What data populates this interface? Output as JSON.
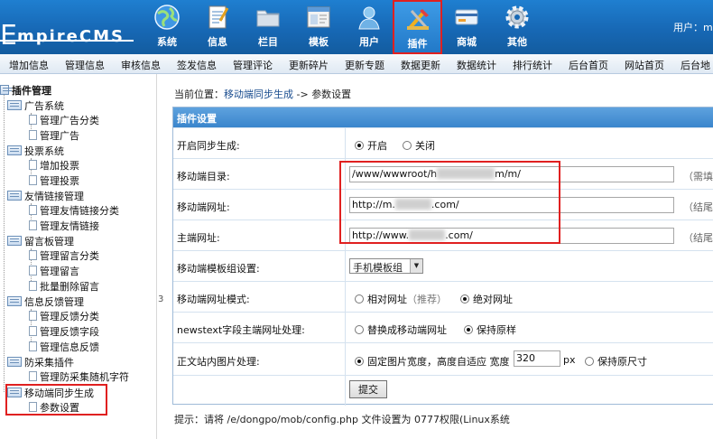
{
  "header": {
    "logo_first": "E",
    "logo_rest": "mpireCMS",
    "user_label": "用户：m",
    "nav": [
      {
        "label": "系统",
        "icon": "globe-icon"
      },
      {
        "label": "信息",
        "icon": "document-icon"
      },
      {
        "label": "栏目",
        "icon": "folder-icon"
      },
      {
        "label": "模板",
        "icon": "window-icon"
      },
      {
        "label": "用户",
        "icon": "user-icon"
      },
      {
        "label": "插件",
        "icon": "tools-icon"
      },
      {
        "label": "商城",
        "icon": "card-icon"
      },
      {
        "label": "其他",
        "icon": "gear-icon"
      }
    ],
    "active_nav": "插件"
  },
  "toolbar": [
    "增加信息",
    "管理信息",
    "审核信息",
    "签发信息",
    "管理评论",
    "更新碎片",
    "更新专题",
    "数据更新",
    "数据统计",
    "排行统计",
    "后台首页",
    "网站首页",
    "后台地"
  ],
  "sidebar": {
    "root": "插件管理",
    "groups": [
      {
        "label": "广告系统",
        "children": [
          "管理广告分类",
          "管理广告"
        ]
      },
      {
        "label": "投票系统",
        "children": [
          "增加投票",
          "管理投票"
        ]
      },
      {
        "label": "友情链接管理",
        "children": [
          "管理友情链接分类",
          "管理友情链接"
        ]
      },
      {
        "label": "留言板管理",
        "children": [
          "管理留言分类",
          "管理留言",
          "批量删除留言"
        ]
      },
      {
        "label": "信息反馈管理",
        "children": [
          "管理反馈分类",
          "管理反馈字段",
          "管理信息反馈"
        ]
      },
      {
        "label": "防采集插件",
        "children": [
          "管理防采集随机字符"
        ]
      },
      {
        "label": "移动端同步生成",
        "children": [
          "参数设置"
        ]
      }
    ],
    "toggle": "3"
  },
  "breadcrumb": {
    "prefix": "当前位置：",
    "link": "移动端同步生成",
    "separator": " -> ",
    "current": "参数设置"
  },
  "panel": {
    "title": "插件设置",
    "enable": {
      "label": "开启同步生成:",
      "on": "开启",
      "off": "关闭",
      "value": "on"
    },
    "mobile_dir": {
      "label": "移动端目录:",
      "value_start": "/www/wwwroot/h",
      "value_end": "m/m/",
      "hint": "（需填写"
    },
    "mobile_url": {
      "label": "移动端网址:",
      "value_start": "http://m.",
      "value_end": ".com/",
      "hint": "（结尾需"
    },
    "main_url": {
      "label": "主端网址:",
      "value_start": "http://www.",
      "value_end": ".com/",
      "hint": "（结尾需"
    },
    "template_group": {
      "label": "移动端模板组设置:",
      "value": "手机模板组"
    },
    "url_mode": {
      "label": "移动端网址模式:",
      "relative": "相对网址",
      "relative_note": "（推荐）",
      "absolute": "绝对网址",
      "value": "absolute"
    },
    "newstext": {
      "label": "newstext字段主端网址处理:",
      "replace": "替换成移动端网址",
      "keep": "保持原样",
      "value": "keep"
    },
    "image": {
      "label": "正文站内图片处理:",
      "fixed": "固定图片宽度，高度自适应 宽度",
      "width": "320",
      "unit": "px",
      "original": "保持原尺寸",
      "value": "fixed"
    },
    "submit": "提交"
  },
  "tip": "提示：请将 /e/dongpo/mob/config.php 文件设置为 0777权限(Linux系统"
}
